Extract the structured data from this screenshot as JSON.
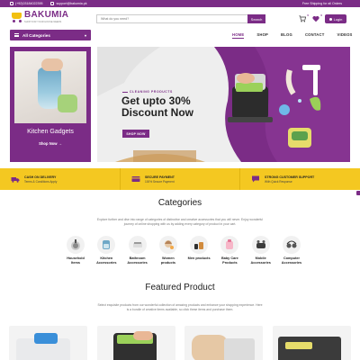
{
  "topbar": {
    "phone": "(+92)03184022395",
    "email": "support@bakumia.pk",
    "promo": "Free Shipping for all Orders"
  },
  "header": {
    "logo_text": "BAKUMIA",
    "logo_tagline": "SHOP FOR YOUR HOUSE NEEDS",
    "search_placeholder": "What do you need?",
    "search_button": "Search",
    "cart_count": "0",
    "wishlist_count": "0",
    "login_label": "Login"
  },
  "nav": {
    "all_categories": "All Categories",
    "links": [
      "HOME",
      "SHOP",
      "BLOG",
      "CONTACT",
      "VIDEOS"
    ]
  },
  "side_promo": {
    "title": "Kitchen Gadgets",
    "cta": "Shop Now →"
  },
  "hero": {
    "eyebrow": "CLEANING PRODUCTS",
    "headline": "Get upto 30% Discount Now",
    "cta": "SHOP NOW"
  },
  "features": [
    {
      "title": "CASH ON DELIVERY",
      "subtitle": "Terms & Conditions Apply"
    },
    {
      "title": "SECURE PAYMENT",
      "subtitle": "100% Secure Payment"
    },
    {
      "title": "STRONG CUSTOMER SUPPORT",
      "subtitle": "With Quick Response"
    }
  ],
  "categories": {
    "title": "Categories",
    "description": "Explore further and dive into range of categories of distinctive and creative accessories that you will never. Enjoy wonderful journey of online shopping with us by adding every category of product in your cart.",
    "items": [
      {
        "label": "Household Items",
        "icon": "household-icon"
      },
      {
        "label": "Kitchen Accessories",
        "icon": "kitchen-icon"
      },
      {
        "label": "Bathroom Accessories",
        "icon": "bathroom-icon"
      },
      {
        "label": "Women products",
        "icon": "women-icon"
      },
      {
        "label": "Men products",
        "icon": "men-icon"
      },
      {
        "label": "Baby Care Products",
        "icon": "baby-icon"
      },
      {
        "label": "Mobile Accessories",
        "icon": "mobile-icon"
      },
      {
        "label": "Computer Accessories",
        "icon": "computer-icon"
      }
    ]
  },
  "featured": {
    "title": "Featured Product",
    "description": "Select exquisite products from our wonderful collection of amazing products and enhance your shopping experience. Here is a bundle of creative items available, so click these items and purchase them."
  },
  "colors": {
    "brand": "#7b2c86",
    "accent": "#f4c821"
  }
}
